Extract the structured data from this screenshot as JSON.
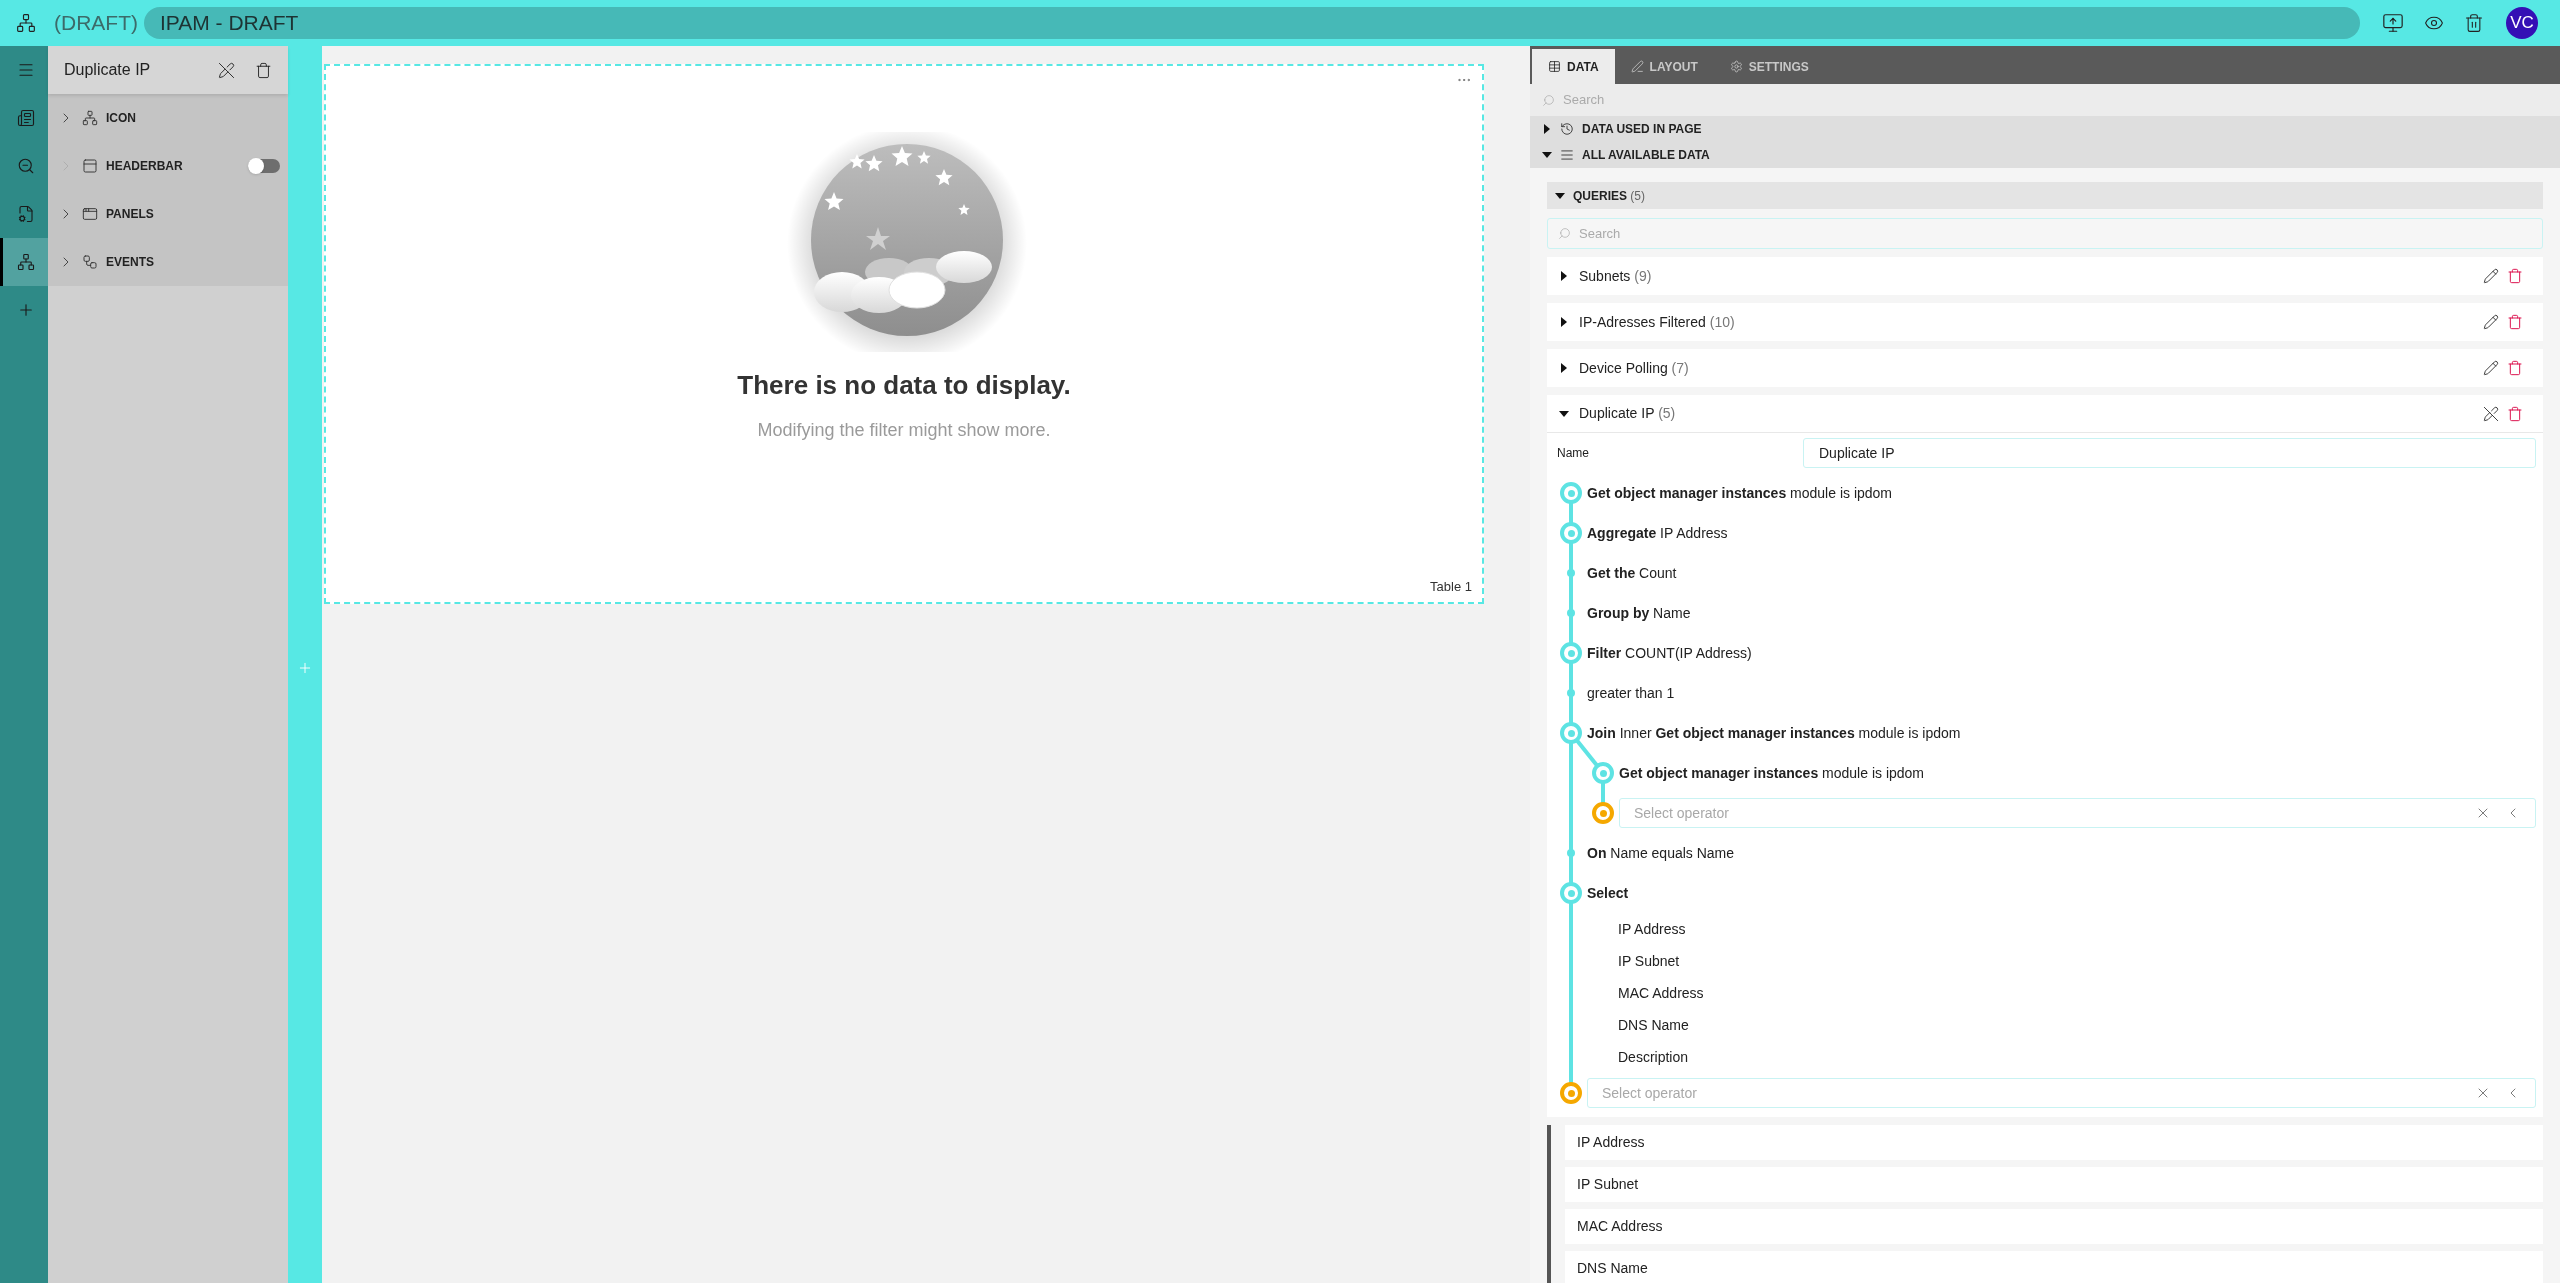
{
  "topbar": {
    "draft_label": "(DRAFT)",
    "title": "IPAM - DRAFT",
    "avatar": "VC"
  },
  "rail": [
    {
      "selected": false
    },
    {
      "selected": false
    },
    {
      "selected": false
    },
    {
      "selected": false
    },
    {
      "selected": true
    },
    {
      "selected": false
    }
  ],
  "component_panel": {
    "title": "Duplicate IP",
    "items": [
      {
        "label": "ICON",
        "expandable": true
      },
      {
        "label": "HEADERBAR",
        "expandable": false,
        "toggle": {
          "on": false
        }
      },
      {
        "label": "PANELS",
        "expandable": true
      },
      {
        "label": "EVENTS",
        "expandable": true
      }
    ]
  },
  "canvas": {
    "empty_title": "There is no data to display.",
    "empty_subtitle": "Modifying the filter might show more.",
    "widget_label": "Table 1"
  },
  "data_panel": {
    "tabs": [
      {
        "label": "DATA",
        "selected": true
      },
      {
        "label": "LAYOUT",
        "selected": false
      },
      {
        "label": "SETTINGS",
        "selected": false
      }
    ],
    "search": {
      "placeholder": "Search"
    },
    "sections": [
      {
        "label": "DATA USED IN PAGE",
        "expanded": false
      },
      {
        "label": "ALL AVAILABLE DATA",
        "expanded": true
      }
    ],
    "queries": {
      "label": "QUERIES",
      "count": "(5)",
      "expanded": true,
      "search": {
        "placeholder": "Search"
      },
      "items": [
        {
          "name": "Subnets",
          "count": "(9)",
          "expanded": false,
          "editing": false
        },
        {
          "name": "IP-Adresses Filtered",
          "count": "(10)",
          "expanded": false,
          "editing": false
        },
        {
          "name": "Device Polling",
          "count": "(7)",
          "expanded": false,
          "editing": false
        },
        {
          "name": "Duplicate IP",
          "count": "(5)",
          "expanded": true,
          "editing": true,
          "detail": {
            "name_label": "Name",
            "name_value": "Duplicate IP",
            "steps": [
              {
                "kind": "major",
                "text": "**Get object manager instances** module is ipdom"
              },
              {
                "kind": "major",
                "text": "**Aggregate** IP Address"
              },
              {
                "kind": "minor",
                "text": "**Get the** Count"
              },
              {
                "kind": "minor",
                "text": "**Group by** Name"
              },
              {
                "kind": "major",
                "text": "**Filter** COUNT(IP Address)"
              },
              {
                "kind": "minor",
                "text": "greater than 1"
              },
              {
                "kind": "major",
                "text": "**Join** Inner **Get object manager instances** module is ipdom",
                "children": [
                  {
                    "kind": "major",
                    "text": "**Get object manager instances** module is ipdom"
                  },
                  {
                    "kind": "operator",
                    "placeholder": "Select operator"
                  }
                ]
              },
              {
                "kind": "minor",
                "text": "**On** Name equals Name"
              },
              {
                "kind": "major",
                "text": "**Select**",
                "fields": [
                  "IP Address",
                  "IP Subnet",
                  "MAC Address",
                  "DNS Name",
                  "Description"
                ]
              },
              {
                "kind": "operator",
                "placeholder": "Select operator"
              }
            ]
          }
        }
      ]
    },
    "fields": [
      "IP Address",
      "IP Subnet",
      "MAC Address",
      "DNS Name"
    ]
  }
}
